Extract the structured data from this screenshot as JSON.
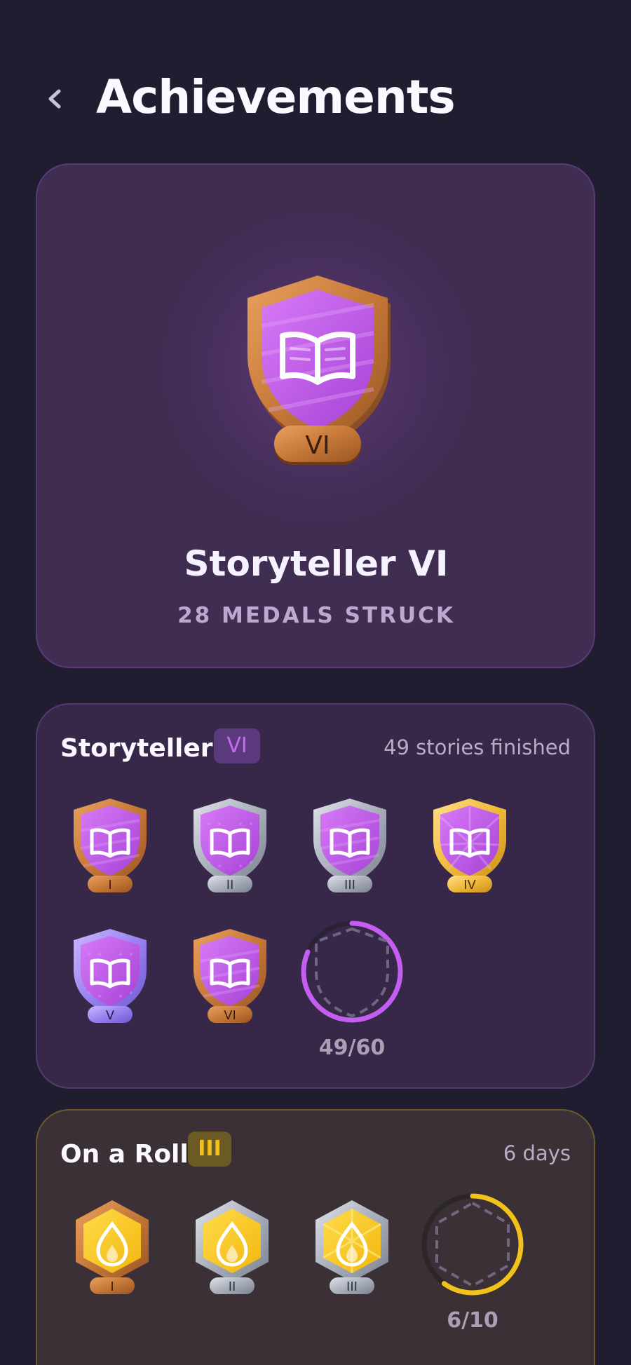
{
  "header": {
    "title": "Achievements",
    "back_icon": "chevron-left-icon"
  },
  "hero": {
    "medal_icon": "open-book-icon",
    "medal_tier": "VI",
    "name": "Storyteller VI",
    "subtitle": "28 MEDALS STRUCK",
    "accent": "#c45ef0"
  },
  "storyteller": {
    "title": "Storyteller",
    "tier": "VI",
    "stat": "49 stories finished",
    "medal_icon": "open-book-icon",
    "medals": [
      {
        "tier": "I",
        "material": "bronze"
      },
      {
        "tier": "II",
        "material": "silver"
      },
      {
        "tier": "III",
        "material": "silver"
      },
      {
        "tier": "IV",
        "material": "gold"
      },
      {
        "tier": "V",
        "material": "lavender"
      },
      {
        "tier": "VI",
        "material": "bronze"
      }
    ],
    "next": {
      "progress_label": "49/60",
      "progress": 0.8167,
      "color": "#c45ef0"
    }
  },
  "on_a_roll": {
    "title": "On a Roll",
    "tier": "III",
    "stat": "6 days",
    "medal_icon": "flame-icon",
    "medals": [
      {
        "tier": "I",
        "material": "bronze"
      },
      {
        "tier": "II",
        "material": "silver"
      },
      {
        "tier": "III",
        "material": "silver"
      }
    ],
    "next": {
      "progress_label": "6/10",
      "progress": 0.6,
      "color": "#f2c21b"
    }
  }
}
